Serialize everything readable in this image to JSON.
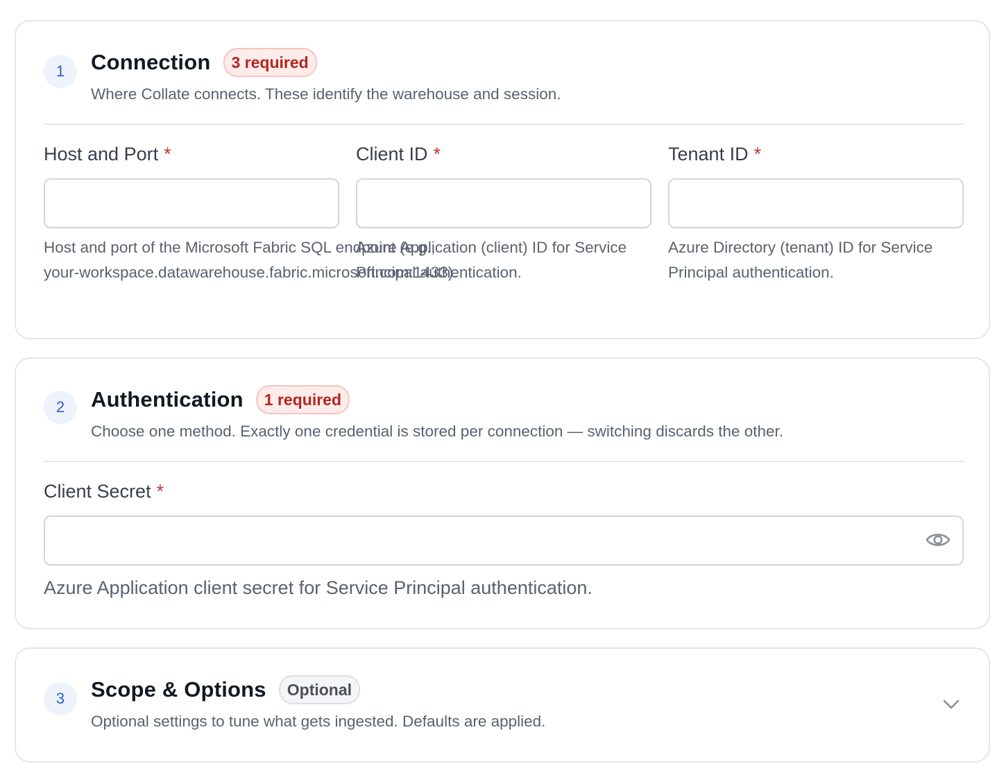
{
  "sections": [
    {
      "number": "1",
      "title": "Connection",
      "badge": "3 required",
      "description": "Where Collate connects. These identify the warehouse and session.",
      "fields": [
        {
          "label": "Host and Port",
          "required_mark": "*",
          "value": "",
          "help": "Host and port of the Microsoft Fabric SQL endpoint (e.g., your-workspace.datawarehouse.fabric.microsoft.com:1433)."
        },
        {
          "label": "Client ID",
          "required_mark": "*",
          "value": "",
          "help": "Azure Application (client) ID for Service Principal authentication."
        },
        {
          "label": "Tenant ID",
          "required_mark": "*",
          "value": "",
          "help": "Azure Directory (tenant) ID for Service Principal authentication."
        }
      ]
    },
    {
      "number": "2",
      "title": "Authentication",
      "badge": "1 required",
      "description": "Choose one method. Exactly one credential is stored per connection — switching discards the other.",
      "fields": [
        {
          "label": "Client Secret",
          "required_mark": "*",
          "value": "",
          "help": "Azure Application client secret for Service Principal authentication.",
          "icon": "eye-icon"
        }
      ]
    },
    {
      "number": "3",
      "title": "Scope & Options",
      "badge": "Optional",
      "description": "Optional settings to tune what gets ingested. Defaults are applied.",
      "collapsed": true,
      "icon": "chevron-down-icon"
    }
  ],
  "colors": {
    "accent": "#2f5fc4",
    "required_badge_bg": "#fdecea",
    "required_badge_text": "#b3261e",
    "required_star": "#c0392b",
    "border": "#e4e6ea"
  }
}
